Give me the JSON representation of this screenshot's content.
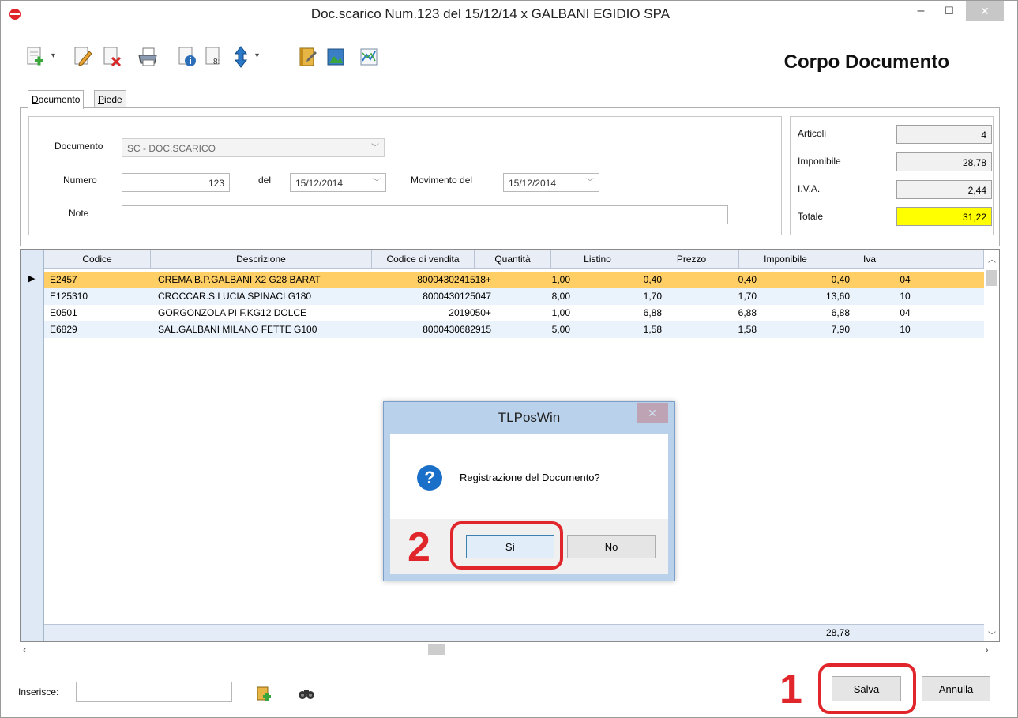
{
  "window": {
    "title": "Doc.scarico  Num.123  del 15/12/14 x GALBANI EGIDIO SPA",
    "minimize": "–",
    "maximize": "☐",
    "close": "✕"
  },
  "toolbar": {
    "icons": [
      "add-icon",
      "edit-icon",
      "delete-icon",
      "print-icon",
      "info-icon",
      "numbering-icon",
      "sort-icon",
      "notebook-icon",
      "image-icon",
      "chart-icon"
    ],
    "dropdown_arrow": "▾"
  },
  "heading": "Corpo Documento",
  "tabs": [
    {
      "label_prefix": "",
      "label_underline": "D",
      "label_rest": "ocumento"
    },
    {
      "label_prefix": "",
      "label_underline": "P",
      "label_rest": "iede"
    }
  ],
  "form": {
    "documento_label": "Documento",
    "documento_value": "SC - DOC.SCARICO",
    "numero_label": "Numero",
    "numero_value": "123",
    "del_label": "del",
    "del_value": "15/12/2014",
    "movimento_label": "Movimento del",
    "movimento_value": "15/12/2014",
    "note_label": "Note",
    "note_value": ""
  },
  "summary": {
    "articoli_label": "Articoli",
    "articoli_value": "4",
    "imponibile_label": "Imponibile",
    "imponibile_value": "28,78",
    "iva_label": "I.V.A.",
    "iva_value": "2,44",
    "totale_label": "Totale",
    "totale_value": "31,22"
  },
  "grid": {
    "columns": [
      "Codice",
      "Descrizione",
      "Codice di vendita",
      "Quantità",
      "Listino",
      "Prezzo",
      "Imponibile",
      "Iva"
    ],
    "rows": [
      {
        "codice": "E2457",
        "descrizione": "CREMA B.P.GALBANI X2 G28 BARAT",
        "codice_vendita": "8000430241518+",
        "quantita": "1,00",
        "listino": "0,40",
        "prezzo": "0,40",
        "imponibile": "0,40",
        "iva": "04"
      },
      {
        "codice": "E125310",
        "descrizione": "CROCCAR.S.LUCIA SPINACI G180",
        "codice_vendita": "8000430125047",
        "quantita": "8,00",
        "listino": "1,70",
        "prezzo": "1,70",
        "imponibile": "13,60",
        "iva": "10"
      },
      {
        "codice": "E0501",
        "descrizione": "GORGONZOLA PI F.KG12 DOLCE",
        "codice_vendita": "2019050+",
        "quantita": "1,00",
        "listino": "6,88",
        "prezzo": "6,88",
        "imponibile": "6,88",
        "iva": "04"
      },
      {
        "codice": "E6829",
        "descrizione": "SAL.GALBANI MILANO FETTE G100",
        "codice_vendita": "8000430682915",
        "quantita": "5,00",
        "listino": "1,58",
        "prezzo": "1,58",
        "imponibile": "7,90",
        "iva": "10"
      }
    ],
    "footer_imponibile": "28,78",
    "row_pointer": "▶"
  },
  "dialog": {
    "title": "TLPosWin",
    "close": "✕",
    "icon": "?",
    "message": "Registrazione del Documento?",
    "yes": "Sì",
    "no": "No"
  },
  "bottom": {
    "inserisce_label": "Inserisce:",
    "inserisce_value": "",
    "salva_underline": "S",
    "salva_rest": "alva",
    "annulla_underline": "A",
    "annulla_rest": "nnulla"
  },
  "annotations": {
    "step1": "1",
    "step2": "2",
    "highlight_color": "#e0262b"
  },
  "colors": {
    "selected_row": "#ffcf66",
    "alt_row": "#eaf2fb",
    "totale_bg": "#ffff00"
  }
}
